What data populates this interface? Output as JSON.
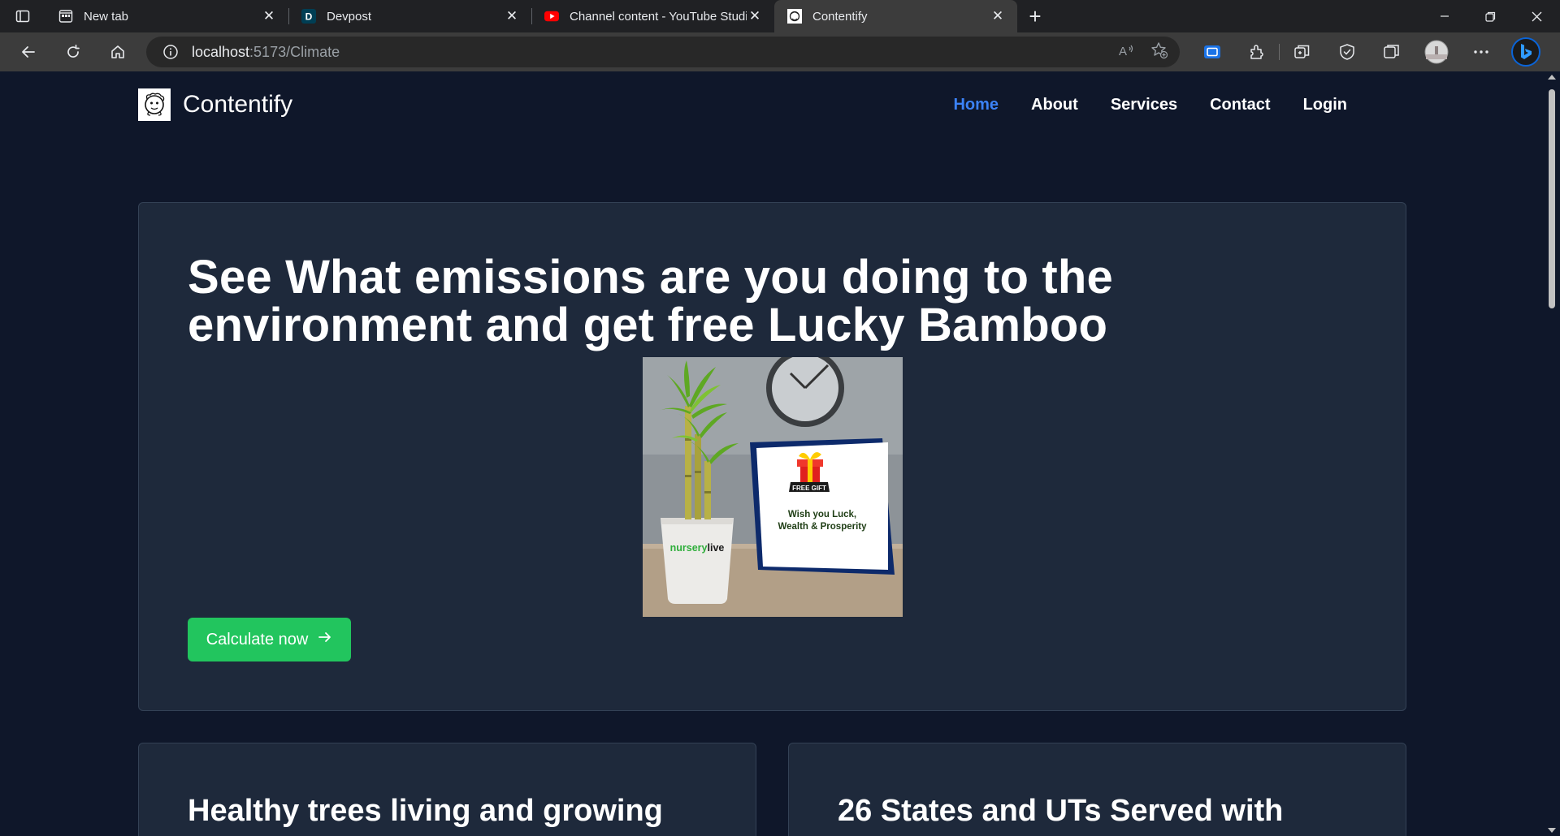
{
  "browser": {
    "tabs": [
      {
        "title": "New tab",
        "icon": "newtab-icon",
        "active": false
      },
      {
        "title": "Devpost",
        "icon": "devpost-icon",
        "active": false
      },
      {
        "title": "Channel content - YouTube Studio",
        "icon": "youtube-icon",
        "active": false
      },
      {
        "title": "Contentify",
        "icon": "contentify-icon",
        "active": true
      }
    ],
    "address": {
      "host": "localhost",
      "path": ":5173/Climate"
    }
  },
  "site": {
    "brand": "Contentify",
    "nav": [
      {
        "label": "Home",
        "active": true
      },
      {
        "label": "About",
        "active": false
      },
      {
        "label": "Services",
        "active": false
      },
      {
        "label": "Contact",
        "active": false
      },
      {
        "label": "Login",
        "active": false
      }
    ],
    "hero": {
      "heading": "See What emissions are you doing to the environment and get free Lucky Bamboo",
      "cta_label": "Calculate now",
      "product_image": {
        "pot_brand_prefix": "nursery",
        "pot_brand_suffix": "live",
        "gift_badge": "FREE GIFT",
        "card_line1": "Wish you Luck,",
        "card_line2": "Wealth & Prosperity"
      }
    },
    "cards": [
      {
        "heading": "Healthy trees living and growing"
      },
      {
        "heading": "26 States and UTs Served with"
      }
    ]
  },
  "colors": {
    "page_bg": "#0f172a",
    "panel_bg": "#1e293b",
    "accent_blue": "#3b82f6",
    "cta_green": "#22c55e"
  }
}
